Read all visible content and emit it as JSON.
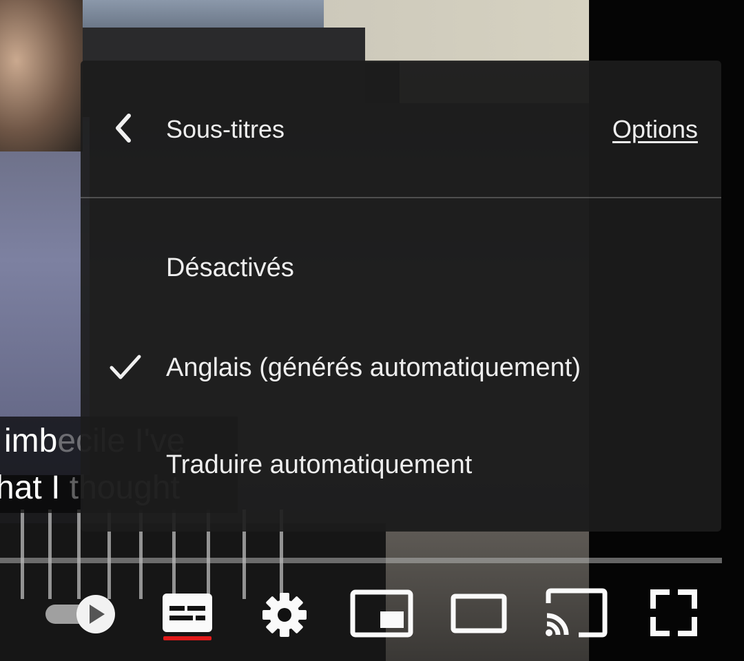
{
  "captions": {
    "line1_bright": "imb",
    "line1_faded": "ecile I've",
    "line2_bright": "hat I",
    "line2_faded": "thought"
  },
  "subtitles_menu": {
    "title": "Sous-titres",
    "options_label": "Options",
    "items": [
      {
        "label": "Désactivés",
        "selected": false
      },
      {
        "label": "Anglais (générés automatiquement)",
        "selected": true
      },
      {
        "label": "Traduire automatiquement",
        "selected": false
      }
    ]
  },
  "controls": {
    "autoplay_toggle": "autoplay-toggle-icon",
    "subtitles": "subtitles-icon",
    "settings": "gear-icon",
    "miniplayer": "miniplayer-icon",
    "theater": "theater-mode-icon",
    "cast": "cast-icon",
    "fullscreen": "fullscreen-icon"
  },
  "colors": {
    "accent_red": "#e21a1a",
    "menu_bg": "#1c1c1c",
    "text": "#eeeeee"
  }
}
